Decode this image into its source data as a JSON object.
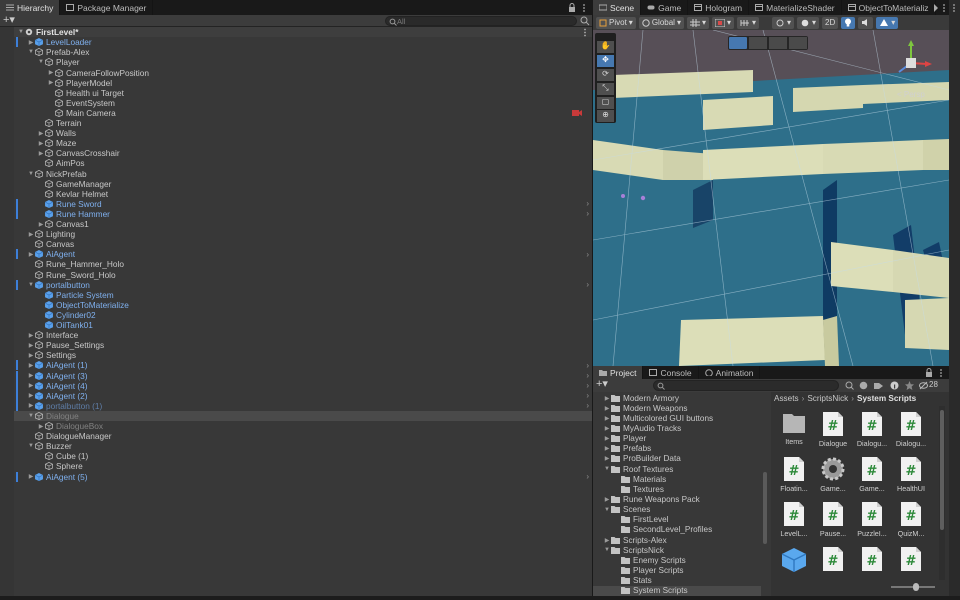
{
  "hierarchy": {
    "tabs": [
      {
        "label": "Hierarchy",
        "active": true
      },
      {
        "label": "Package Manager",
        "active": false
      }
    ],
    "search_placeholder": "All",
    "scene_name": "FirstLevel*",
    "rows": [
      {
        "label": "LevelLoader",
        "depth": 1,
        "fold": "collapsed",
        "kind": "prefab",
        "bar": true
      },
      {
        "label": "Prefab-Alex",
        "depth": 1,
        "fold": "expanded",
        "kind": "object"
      },
      {
        "label": "Player",
        "depth": 2,
        "fold": "expanded",
        "kind": "object"
      },
      {
        "label": "CameraFollowPosition",
        "depth": 3,
        "fold": "collapsed",
        "kind": "object"
      },
      {
        "label": "PlayerModel",
        "depth": 3,
        "fold": "collapsed",
        "kind": "object"
      },
      {
        "label": "Health ui Target",
        "depth": 3,
        "fold": "none",
        "kind": "object"
      },
      {
        "label": "EventSystem",
        "depth": 3,
        "fold": "none",
        "kind": "object"
      },
      {
        "label": "Main Camera",
        "depth": 3,
        "fold": "none",
        "kind": "object",
        "badge": true
      },
      {
        "label": "Terrain",
        "depth": 2,
        "fold": "none",
        "kind": "object"
      },
      {
        "label": "Walls",
        "depth": 2,
        "fold": "collapsed",
        "kind": "object"
      },
      {
        "label": "Maze",
        "depth": 2,
        "fold": "collapsed",
        "kind": "object"
      },
      {
        "label": "CanvasCrosshair",
        "depth": 2,
        "fold": "collapsed",
        "kind": "object"
      },
      {
        "label": "AimPos",
        "depth": 2,
        "fold": "none",
        "kind": "object"
      },
      {
        "label": "NickPrefab",
        "depth": 1,
        "fold": "expanded",
        "kind": "object"
      },
      {
        "label": "GameManager",
        "depth": 2,
        "fold": "none",
        "kind": "object"
      },
      {
        "label": "Kevlar Helmet",
        "depth": 2,
        "fold": "none",
        "kind": "object"
      },
      {
        "label": "Rune Sword",
        "depth": 2,
        "fold": "none",
        "kind": "prefab",
        "bar": true,
        "arrow": true
      },
      {
        "label": "Rune Hammer",
        "depth": 2,
        "fold": "none",
        "kind": "prefab",
        "bar": true,
        "arrow": true
      },
      {
        "label": "Canvas1",
        "depth": 2,
        "fold": "collapsed",
        "kind": "object"
      },
      {
        "label": "Lighting",
        "depth": 1,
        "fold": "collapsed",
        "kind": "object"
      },
      {
        "label": "Canvas",
        "depth": 1,
        "fold": "none",
        "kind": "object"
      },
      {
        "label": "AiAgent",
        "depth": 1,
        "fold": "collapsed",
        "kind": "prefab",
        "bar": true,
        "arrow": true
      },
      {
        "label": "Rune_Hammer_Holo",
        "depth": 1,
        "fold": "none",
        "kind": "object"
      },
      {
        "label": "Rune_Sword_Holo",
        "depth": 1,
        "fold": "none",
        "kind": "object"
      },
      {
        "label": "portalbutton",
        "depth": 1,
        "fold": "expanded",
        "kind": "prefab",
        "bar": true,
        "arrow": true
      },
      {
        "label": "Particle System",
        "depth": 2,
        "fold": "none",
        "kind": "prefab"
      },
      {
        "label": "ObjectToMaterialize",
        "depth": 2,
        "fold": "none",
        "kind": "prefab"
      },
      {
        "label": "Cylinder02",
        "depth": 2,
        "fold": "none",
        "kind": "prefab"
      },
      {
        "label": "OilTank01",
        "depth": 2,
        "fold": "none",
        "kind": "prefab"
      },
      {
        "label": "Interface",
        "depth": 1,
        "fold": "collapsed",
        "kind": "object"
      },
      {
        "label": "Pause_Settings",
        "depth": 1,
        "fold": "collapsed",
        "kind": "object"
      },
      {
        "label": "Settings",
        "depth": 1,
        "fold": "collapsed",
        "kind": "object"
      },
      {
        "label": "AiAgent (1)",
        "depth": 1,
        "fold": "collapsed",
        "kind": "prefab",
        "bar": true,
        "arrow": true
      },
      {
        "label": "AiAgent (3)",
        "depth": 1,
        "fold": "collapsed",
        "kind": "prefab",
        "bar": true,
        "arrow": true
      },
      {
        "label": "AiAgent (4)",
        "depth": 1,
        "fold": "collapsed",
        "kind": "prefab",
        "bar": true,
        "arrow": true
      },
      {
        "label": "AiAgent (2)",
        "depth": 1,
        "fold": "collapsed",
        "kind": "prefab",
        "bar": true,
        "arrow": true
      },
      {
        "label": "portalbutton (1)",
        "depth": 1,
        "fold": "collapsed",
        "kind": "prefab",
        "inactive": true,
        "bar": true,
        "arrow": true
      },
      {
        "label": "Dialogue",
        "depth": 1,
        "fold": "expanded",
        "kind": "object",
        "inactive": true,
        "selected": true
      },
      {
        "label": "DialogueBox",
        "depth": 2,
        "fold": "collapsed",
        "kind": "object",
        "inactive": true
      },
      {
        "label": "DialogueManager",
        "depth": 1,
        "fold": "none",
        "kind": "object"
      },
      {
        "label": "Buzzer",
        "depth": 1,
        "fold": "expanded",
        "kind": "object"
      },
      {
        "label": "Cube (1)",
        "depth": 2,
        "fold": "none",
        "kind": "object"
      },
      {
        "label": "Sphere",
        "depth": 2,
        "fold": "none",
        "kind": "object"
      },
      {
        "label": "AiAgent (5)",
        "depth": 1,
        "fold": "collapsed",
        "kind": "prefab",
        "bar": true,
        "arrow": true
      }
    ]
  },
  "scene_view": {
    "tabs": [
      {
        "label": "Scene",
        "icon": "scene-icon",
        "active": true
      },
      {
        "label": "Game",
        "icon": "game-icon",
        "active": false
      },
      {
        "label": "Hologram",
        "icon": "window-icon",
        "active": false
      },
      {
        "label": "MaterializeShader",
        "icon": "window-icon",
        "active": false
      },
      {
        "label": "ObjectToMaterializ",
        "icon": "window-icon",
        "active": false
      }
    ],
    "pivot_label": "Pivot",
    "global_label": "Global",
    "mode_2d_label": "2D",
    "persp_label": "< Persp"
  },
  "project": {
    "tabs": [
      {
        "label": "Project",
        "icon": "folder-icon",
        "active": true
      },
      {
        "label": "Console",
        "icon": "console-icon",
        "active": false
      },
      {
        "label": "Animation",
        "icon": "animation-icon",
        "active": false
      }
    ],
    "hidden_count": "28",
    "folders": [
      {
        "label": "Modern Armory",
        "depth": 0,
        "fold": "collapsed"
      },
      {
        "label": "Modern Weapons",
        "depth": 0,
        "fold": "collapsed"
      },
      {
        "label": "Multicolored GUI buttons",
        "depth": 0,
        "fold": "collapsed"
      },
      {
        "label": "MyAudio Tracks",
        "depth": 0,
        "fold": "collapsed"
      },
      {
        "label": "Player",
        "depth": 0,
        "fold": "collapsed"
      },
      {
        "label": "Prefabs",
        "depth": 0,
        "fold": "collapsed"
      },
      {
        "label": "ProBuilder Data",
        "depth": 0,
        "fold": "collapsed"
      },
      {
        "label": "Roof Textures",
        "depth": 0,
        "fold": "expanded"
      },
      {
        "label": "Materials",
        "depth": 1,
        "fold": "none"
      },
      {
        "label": "Textures",
        "depth": 1,
        "fold": "none"
      },
      {
        "label": "Rune Weapons Pack",
        "depth": 0,
        "fold": "collapsed"
      },
      {
        "label": "Scenes",
        "depth": 0,
        "fold": "expanded"
      },
      {
        "label": "FirstLevel",
        "depth": 1,
        "fold": "none"
      },
      {
        "label": "SecondLevel_Profiles",
        "depth": 1,
        "fold": "none"
      },
      {
        "label": "Scripts-Alex",
        "depth": 0,
        "fold": "collapsed"
      },
      {
        "label": "ScriptsNick",
        "depth": 0,
        "fold": "expanded"
      },
      {
        "label": "Enemy Scripts",
        "depth": 1,
        "fold": "none"
      },
      {
        "label": "Player Scripts",
        "depth": 1,
        "fold": "none"
      },
      {
        "label": "Stats",
        "depth": 1,
        "fold": "none"
      },
      {
        "label": "System Scripts",
        "depth": 1,
        "fold": "none",
        "selected": true
      }
    ],
    "breadcrumb": [
      "Assets",
      "ScriptsNick",
      "System Scripts"
    ],
    "assets": [
      {
        "label": "Items",
        "type": "folder"
      },
      {
        "label": "Dialogue",
        "type": "script"
      },
      {
        "label": "Dialogu...",
        "type": "script"
      },
      {
        "label": "Dialogu...",
        "type": "script"
      },
      {
        "label": "Floatin...",
        "type": "script"
      },
      {
        "label": "Game...",
        "type": "gear"
      },
      {
        "label": "Game...",
        "type": "script"
      },
      {
        "label": "HealthUI",
        "type": "script"
      },
      {
        "label": "LevelL...",
        "type": "script"
      },
      {
        "label": "Pause...",
        "type": "script"
      },
      {
        "label": "PuzzleI...",
        "type": "script"
      },
      {
        "label": "QuizM...",
        "type": "script"
      },
      {
        "label": "",
        "type": "cube"
      },
      {
        "label": "",
        "type": "script"
      },
      {
        "label": "",
        "type": "script"
      },
      {
        "label": "",
        "type": "script"
      }
    ]
  },
  "colors": {
    "prefab": "#7fb0ee",
    "accent": "#3d7fd8",
    "panel": "#383838",
    "water": "#2c6e8a",
    "wall": "#d9dbb8"
  }
}
